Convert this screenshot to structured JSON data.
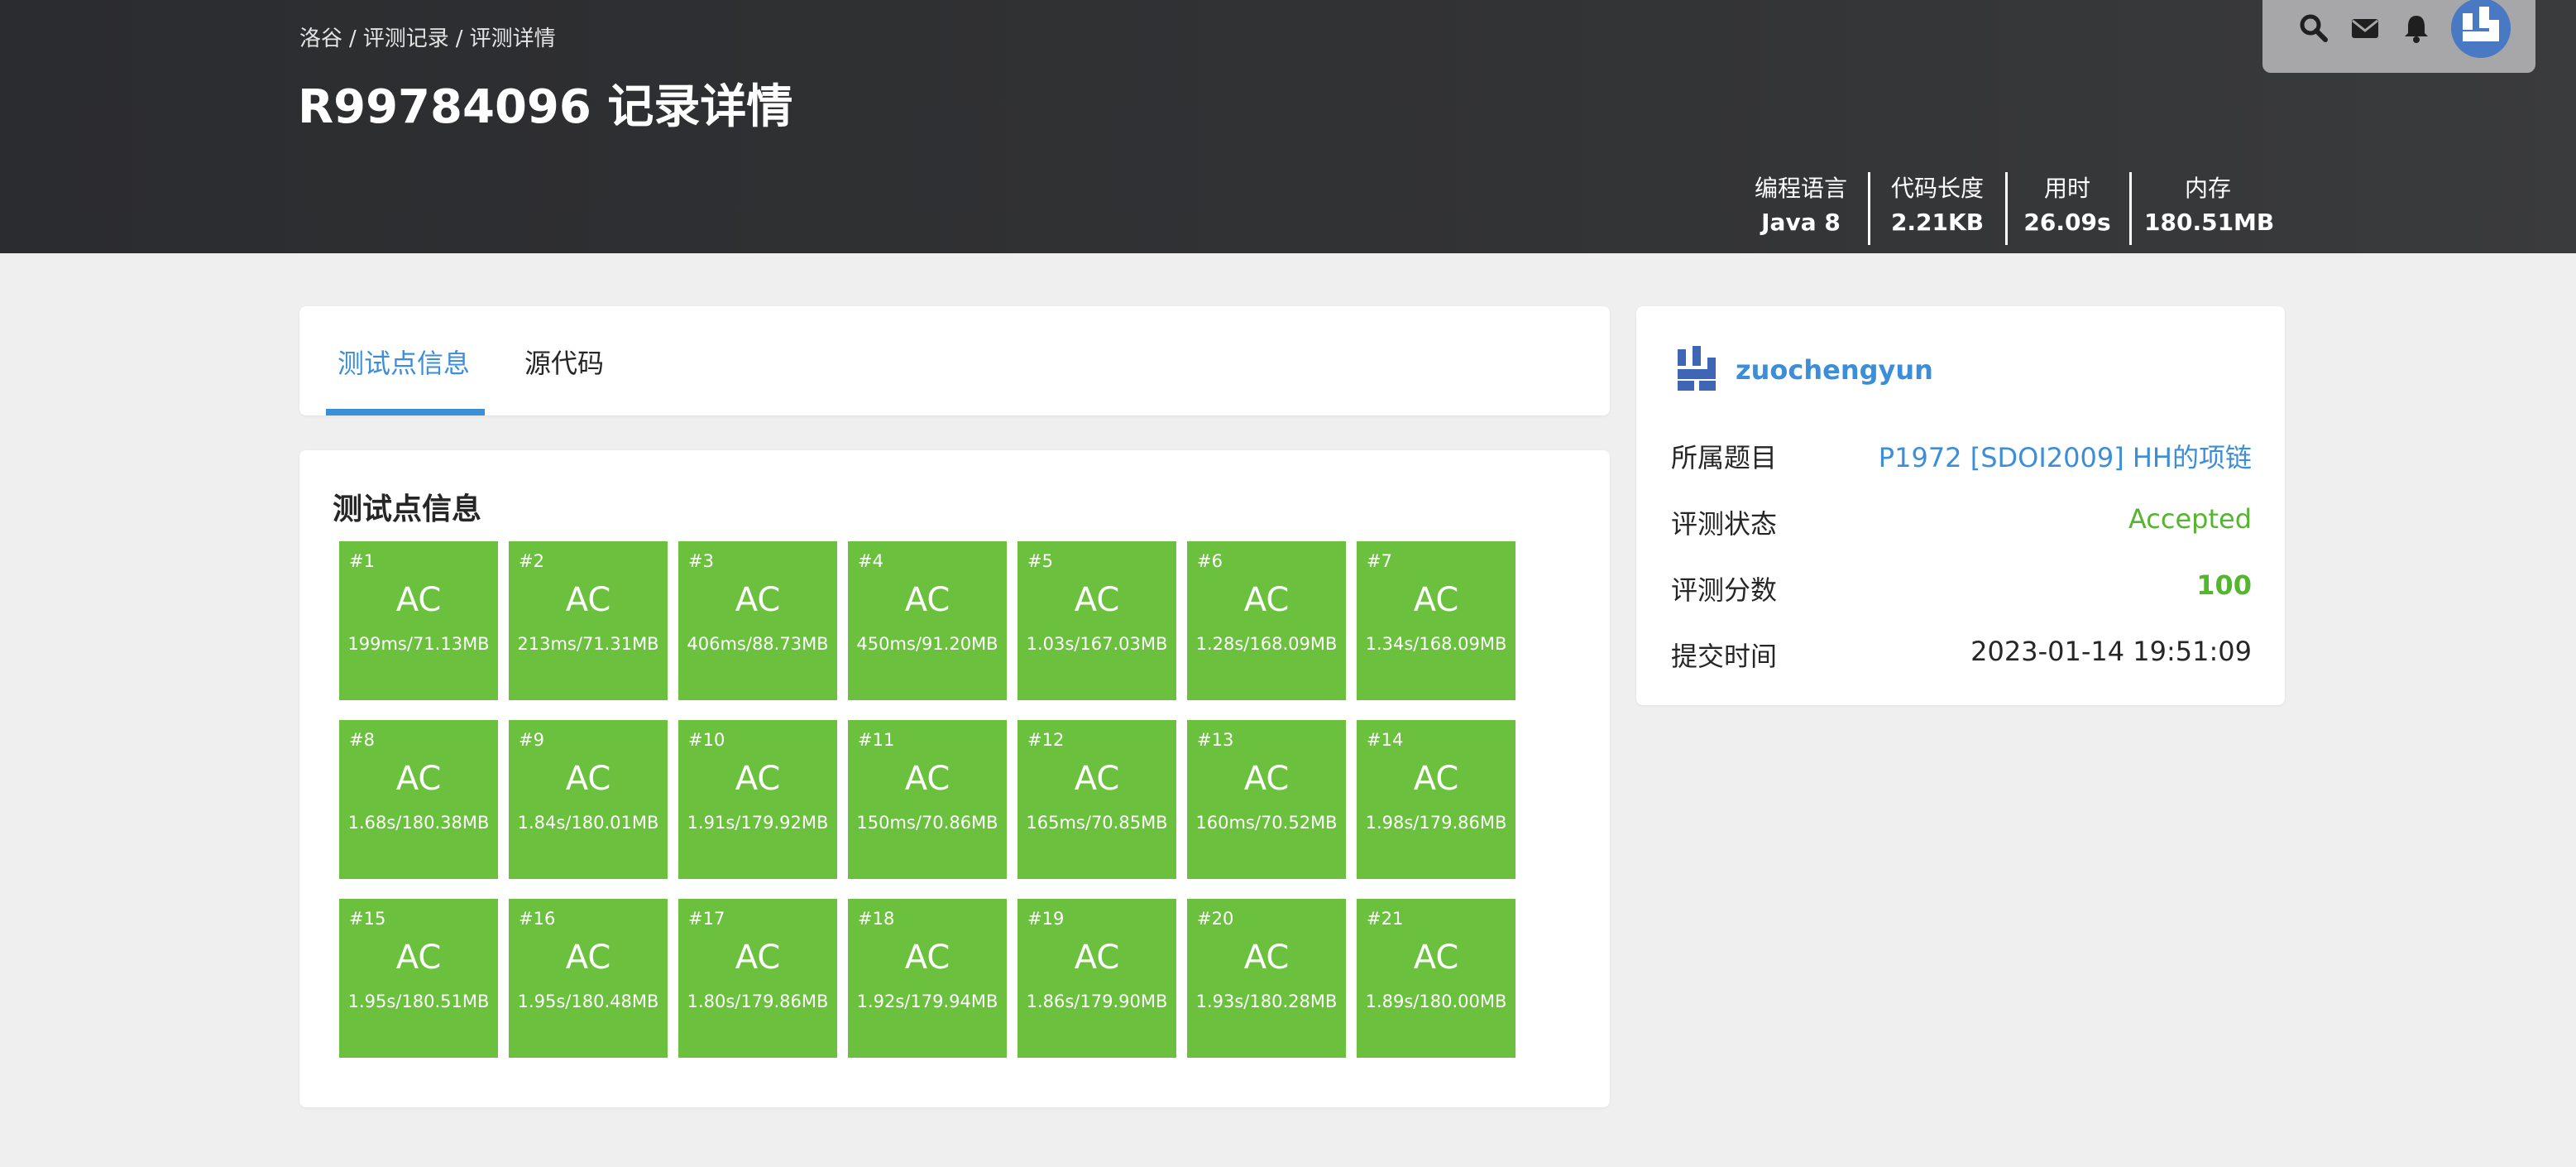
{
  "breadcrumb": [
    "洛谷",
    "评测记录",
    "评测详情"
  ],
  "title": "R99784096 记录详情",
  "stats": [
    {
      "label": "编程语言",
      "value": "Java 8"
    },
    {
      "label": "代码长度",
      "value": "2.21KB"
    },
    {
      "label": "用时",
      "value": "26.09s"
    },
    {
      "label": "内存",
      "value": "180.51MB"
    }
  ],
  "toolbar": {
    "icons": [
      "search-icon",
      "mail-icon",
      "bell-icon",
      "avatar"
    ]
  },
  "tabs": [
    {
      "label": "测试点信息",
      "active": true
    },
    {
      "label": "源代码",
      "active": false
    }
  ],
  "cases_title": "测试点信息",
  "cases": [
    {
      "id": "#1",
      "status": "AC",
      "info": "199ms/71.13MB"
    },
    {
      "id": "#2",
      "status": "AC",
      "info": "213ms/71.31MB"
    },
    {
      "id": "#3",
      "status": "AC",
      "info": "406ms/88.73MB"
    },
    {
      "id": "#4",
      "status": "AC",
      "info": "450ms/91.20MB"
    },
    {
      "id": "#5",
      "status": "AC",
      "info": "1.03s/167.03MB"
    },
    {
      "id": "#6",
      "status": "AC",
      "info": "1.28s/168.09MB"
    },
    {
      "id": "#7",
      "status": "AC",
      "info": "1.34s/168.09MB"
    },
    {
      "id": "#8",
      "status": "AC",
      "info": "1.68s/180.38MB"
    },
    {
      "id": "#9",
      "status": "AC",
      "info": "1.84s/180.01MB"
    },
    {
      "id": "#10",
      "status": "AC",
      "info": "1.91s/179.92MB"
    },
    {
      "id": "#11",
      "status": "AC",
      "info": "150ms/70.86MB"
    },
    {
      "id": "#12",
      "status": "AC",
      "info": "165ms/70.85MB"
    },
    {
      "id": "#13",
      "status": "AC",
      "info": "160ms/70.52MB"
    },
    {
      "id": "#14",
      "status": "AC",
      "info": "1.98s/179.86MB"
    },
    {
      "id": "#15",
      "status": "AC",
      "info": "1.95s/180.51MB"
    },
    {
      "id": "#16",
      "status": "AC",
      "info": "1.95s/180.48MB"
    },
    {
      "id": "#17",
      "status": "AC",
      "info": "1.80s/179.86MB"
    },
    {
      "id": "#18",
      "status": "AC",
      "info": "1.92s/179.94MB"
    },
    {
      "id": "#19",
      "status": "AC",
      "info": "1.86s/179.90MB"
    },
    {
      "id": "#20",
      "status": "AC",
      "info": "1.93s/180.28MB"
    },
    {
      "id": "#21",
      "status": "AC",
      "info": "1.89s/180.00MB"
    }
  ],
  "user": {
    "name": "zuochengyun"
  },
  "info": {
    "problem_label": "所属题目",
    "problem_value": "P1972 [SDOI2009] HH的项链",
    "status_label": "评测状态",
    "status_value": "Accepted",
    "score_label": "评测分数",
    "score_value": "100",
    "time_label": "提交时间",
    "time_value": "2023-01-14 19:51:09"
  },
  "colors": {
    "accent": "#3d8ed8",
    "ac_green": "#6bc13e",
    "accepted_text": "#55b52f",
    "header_bg": "#2e2f31",
    "page_bg": "#efefef"
  }
}
